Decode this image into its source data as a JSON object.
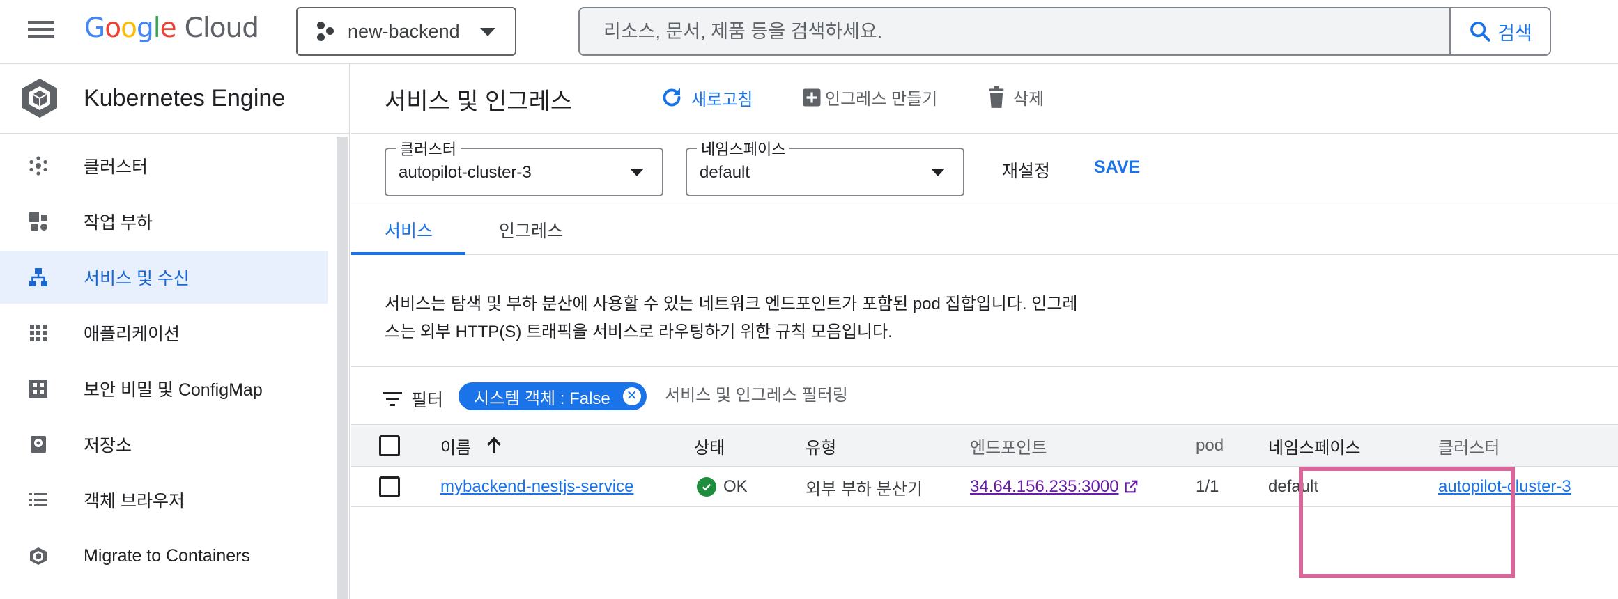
{
  "topbar": {
    "logo": {
      "g": "G",
      "o1": "o",
      "o2": "o",
      "g2": "g",
      "l": "l",
      "e": "e",
      "cloud": "Cloud"
    },
    "project": "new-backend",
    "search": {
      "placeholder": "리소스, 문서, 제품 등을 검색하세요.",
      "button_label": "검색"
    }
  },
  "sidebar": {
    "title": "Kubernetes Engine",
    "items": [
      {
        "label": "클러스터",
        "icon": "cluster-icon"
      },
      {
        "label": "작업 부하",
        "icon": "workloads-icon"
      },
      {
        "label": "서비스 및 수신",
        "icon": "services-icon",
        "active": true
      },
      {
        "label": "애플리케이션",
        "icon": "apps-grid-icon"
      },
      {
        "label": "보안 비밀 및 ConfigMap",
        "icon": "secrets-icon"
      },
      {
        "label": "저장소",
        "icon": "storage-icon"
      },
      {
        "label": "객체 브라우저",
        "icon": "object-browser-icon"
      },
      {
        "label": "Migrate to Containers",
        "icon": "migrate-icon"
      }
    ]
  },
  "page": {
    "title": "서비스 및 인그레스",
    "actions": {
      "refresh": "새로고침",
      "create_ingress": "인그레스 만들기",
      "delete": "삭제"
    },
    "cluster_select": {
      "legend": "클러스터",
      "value": "autopilot-cluster-3"
    },
    "namespace_select": {
      "legend": "네임스페이스",
      "value": "default"
    },
    "reset_label": "재설정",
    "save_label": "SAVE",
    "tabs": [
      {
        "label": "서비스",
        "active": true
      },
      {
        "label": "인그레스",
        "active": false
      }
    ],
    "description_line1": "서비스는 탐색 및 부하 분산에 사용할 수 있는 네트워크 엔드포인트가 포함된 pod 집합입니다. 인그레",
    "description_line2": "스는 외부 HTTP(S) 트래픽을 서비스로 라우팅하기 위한 규칙 모음입니다.",
    "filter": {
      "label": "필터",
      "chip": "시스템 객체 : False",
      "placeholder": "서비스 및 인그레스 필터링"
    }
  },
  "table": {
    "headers": {
      "name": "이름",
      "status": "상태",
      "type": "유형",
      "endpoint": "엔드포인트",
      "pods": "pod",
      "namespace": "네임스페이스",
      "cluster": "클러스터"
    },
    "rows": [
      {
        "name": "mybackend-nestjs-service",
        "status": "OK",
        "type": "외부 부하 분산기",
        "endpoint": "34.64.156.235:3000",
        "pods": "1/1",
        "namespace": "default",
        "cluster": "autopilot-cluster-3"
      }
    ]
  },
  "colors": {
    "accent": "#1a73e8",
    "ok": "#1e8e3e",
    "highlight": "#d9679a",
    "visited_link": "#681da8"
  }
}
